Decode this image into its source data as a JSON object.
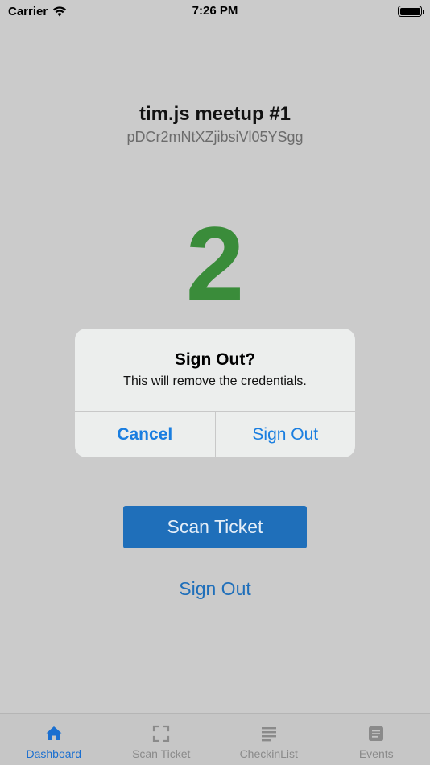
{
  "status_bar": {
    "carrier": "Carrier",
    "time": "7:26 PM"
  },
  "event": {
    "title": "tim.js meetup #1",
    "id": "pDCr2mNtXZjibsiVl05YSgg"
  },
  "checkin_count": "2",
  "alert": {
    "title": "Sign Out?",
    "message": "This will remove the credentials.",
    "cancel_label": "Cancel",
    "confirm_label": "Sign Out"
  },
  "actions": {
    "scan_label": "Scan Ticket",
    "signout_label": "Sign Out"
  },
  "tabs": [
    {
      "label": "Dashboard",
      "icon": "home-icon",
      "active": true
    },
    {
      "label": "Scan Ticket",
      "icon": "scan-frame-icon",
      "active": false
    },
    {
      "label": "CheckinList",
      "icon": "list-icon",
      "active": false
    },
    {
      "label": "Events",
      "icon": "document-icon",
      "active": false
    }
  ],
  "colors": {
    "accent": "#1a6fd0",
    "count_green": "#3a8c3a",
    "button_blue": "#1f6fba"
  }
}
